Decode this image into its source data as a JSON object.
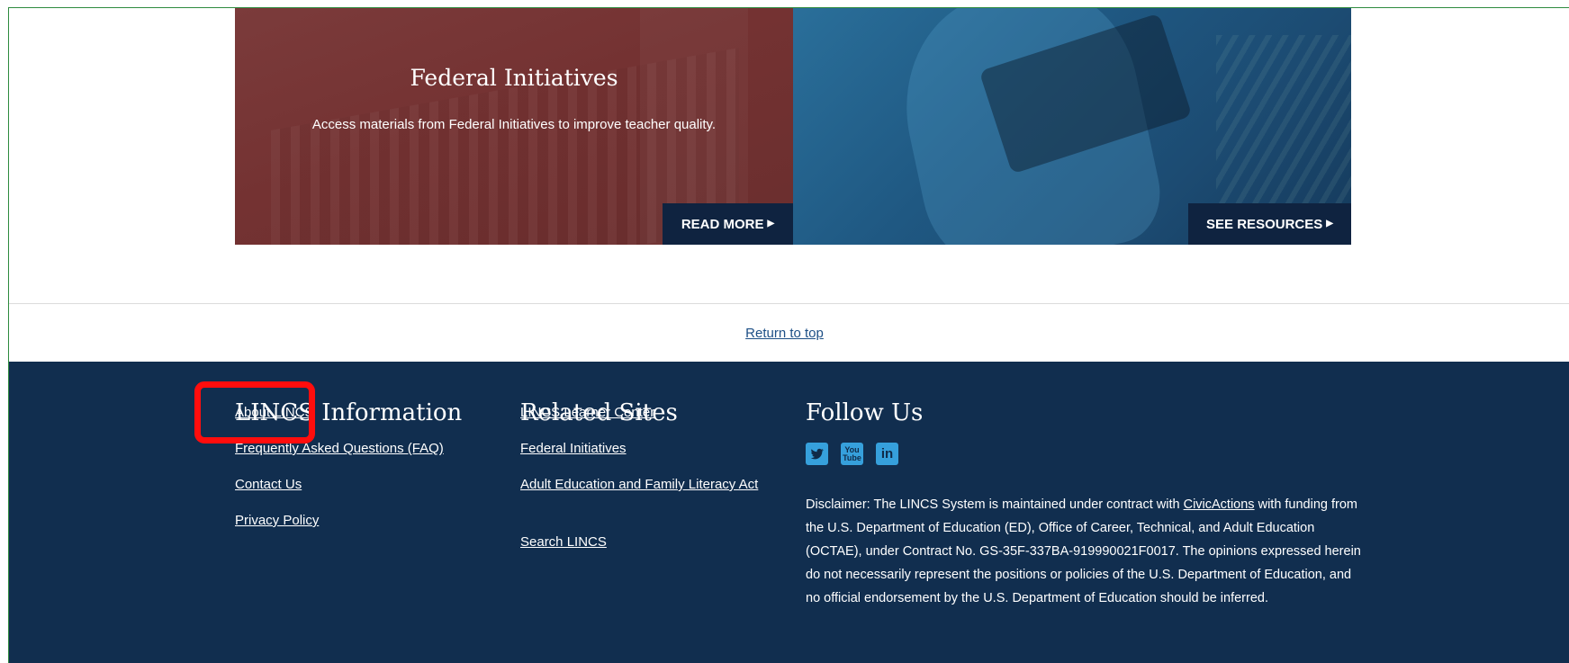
{
  "hero": {
    "left": {
      "title": "Federal Initiatives",
      "description": "Access materials from Federal Initiatives to improve teacher quality.",
      "button_label": "READ MORE",
      "button_icon": "triangle-right-icon"
    },
    "right": {
      "button_label": "SEE RESOURCES",
      "button_icon": "triangle-right-icon"
    }
  },
  "return_to_top": "Return to top",
  "footer": {
    "lincs_information": {
      "heading": "LINCS Information",
      "links": [
        "About LINCS",
        "Frequently Asked Questions (FAQ)",
        "Contact Us",
        "Privacy Policy"
      ]
    },
    "related_sites": {
      "heading": "Related Sites",
      "links": [
        "LINCS Learner Center",
        "Federal Initiatives",
        "Adult Education and Family Literacy Act",
        "Search LINCS"
      ]
    },
    "follow_us": {
      "heading": "Follow Us",
      "social": [
        {
          "name": "Twitter",
          "icon": "twitter-icon"
        },
        {
          "name": "YouTube",
          "icon": "youtube-icon",
          "text_top": "You",
          "text_bottom": "Tube"
        },
        {
          "name": "LinkedIn",
          "icon": "linkedin-icon",
          "text": "in"
        }
      ],
      "disclaimer_before": "Disclaimer: The LINCS System is maintained under contract with ",
      "disclaimer_link": "CivicActions",
      "disclaimer_after": " with funding from the U.S. Department of Education (ED), Office of Career, Technical, and Adult Education (OCTAE), under Contract No. GS-35F-337BA-919990021F0017. The opinions expressed herein do not necessarily represent the positions or policies of the U.S. Department of Education, and no official endorsement by the U.S. Department of Education should be inferred."
    }
  },
  "colors": {
    "footer_bg": "#112e4f",
    "button_bg": "#0f2340",
    "highlight": "#ff0d0d",
    "social_icon": "#36a0dc"
  }
}
